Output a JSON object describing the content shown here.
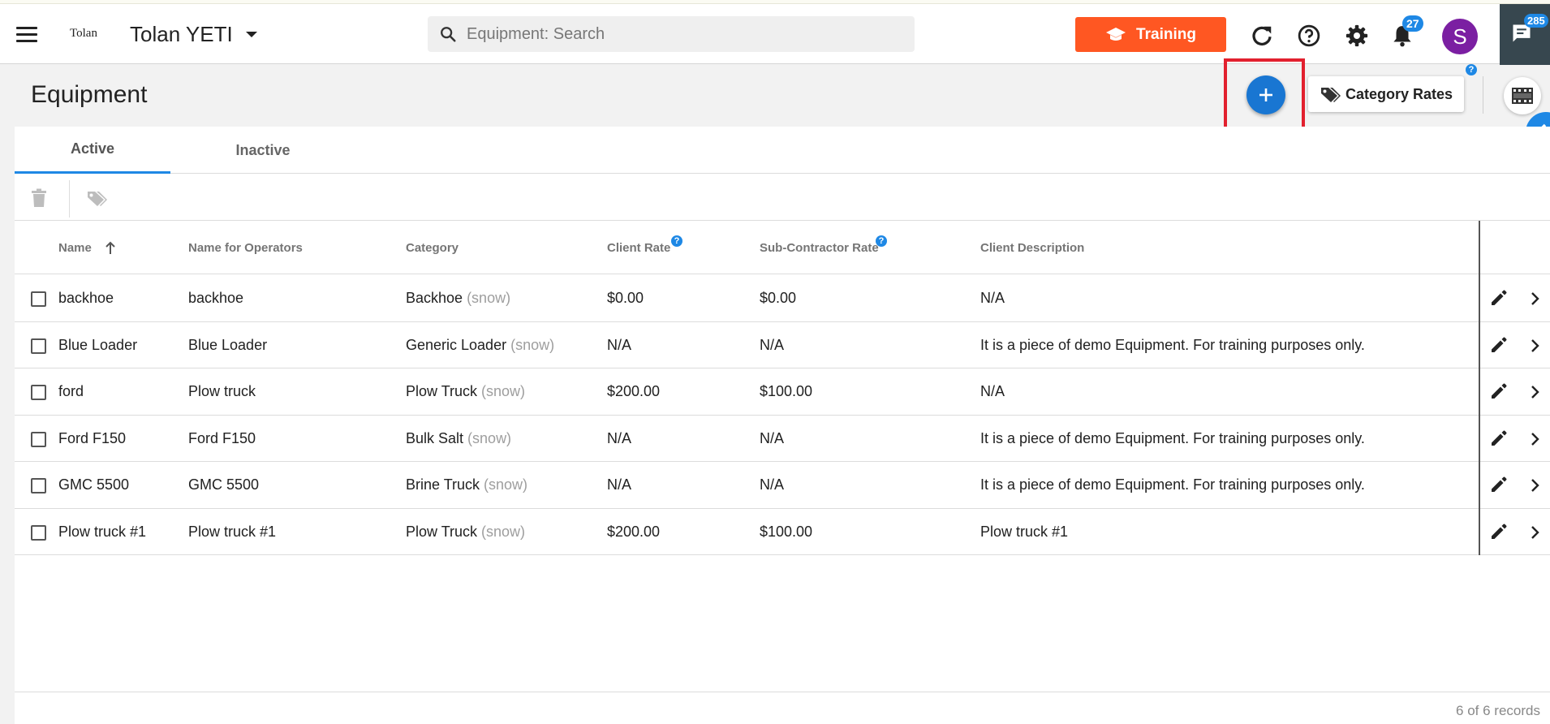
{
  "header": {
    "logo_text": "Tolan",
    "org_name": "Tolan YETI",
    "search_placeholder": "Equipment: Search",
    "training_label": "Training",
    "notifications_count": "27",
    "avatar_initial": "S",
    "messages_count": "285"
  },
  "page": {
    "title": "Equipment",
    "category_rates_label": "Category Rates",
    "help_mark": "?"
  },
  "tabs": [
    {
      "label": "Active",
      "active": true
    },
    {
      "label": "Inactive",
      "active": false
    }
  ],
  "table": {
    "columns": {
      "name": "Name",
      "name_for_operators": "Name for Operators",
      "category": "Category",
      "client_rate": "Client Rate",
      "sub_rate": "Sub-Contractor Rate",
      "client_description": "Client Description"
    },
    "rows": [
      {
        "name": "backhoe",
        "operators": "backhoe",
        "category": "Backhoe",
        "season": "(snow)",
        "client_rate": "$0.00",
        "sub_rate": "$0.00",
        "description": "N/A"
      },
      {
        "name": "Blue Loader",
        "operators": "Blue Loader",
        "category": "Generic Loader",
        "season": "(snow)",
        "client_rate": "N/A",
        "sub_rate": "N/A",
        "description": "It is a piece of demo Equipment. For training purposes only."
      },
      {
        "name": "ford",
        "operators": "Plow truck",
        "category": "Plow Truck",
        "season": "(snow)",
        "client_rate": "$200.00",
        "sub_rate": "$100.00",
        "description": "N/A"
      },
      {
        "name": "Ford F150",
        "operators": "Ford F150",
        "category": "Bulk Salt",
        "season": "(snow)",
        "client_rate": "N/A",
        "sub_rate": "N/A",
        "description": "It is a piece of demo Equipment. For training purposes only."
      },
      {
        "name": "GMC 5500",
        "operators": "GMC 5500",
        "category": "Brine Truck",
        "season": "(snow)",
        "client_rate": "N/A",
        "sub_rate": "N/A",
        "description": "It is a piece of demo Equipment. For training purposes only."
      },
      {
        "name": "Plow truck #1",
        "operators": "Plow truck #1",
        "category": "Plow Truck",
        "season": "(snow)",
        "client_rate": "$200.00",
        "sub_rate": "$100.00",
        "description": "Plow truck #1"
      }
    ]
  },
  "footer": {
    "records_text": "6 of 6 records"
  },
  "colors": {
    "accent": "#1e88e5",
    "training": "#ff5722",
    "avatar": "#7b1fa2",
    "highlight": "#e2202e"
  }
}
